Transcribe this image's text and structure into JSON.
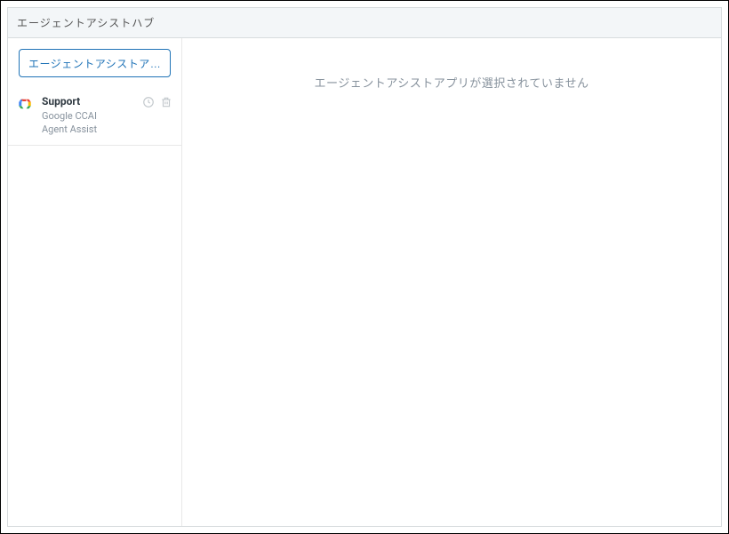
{
  "header": {
    "title": "エージェントアシストハブ"
  },
  "sidebar": {
    "add_button_label": "エージェントアシストアプ...",
    "items": [
      {
        "title": "Support",
        "subtitle_line1": "Google CCAI",
        "subtitle_line2": "Agent Assist"
      }
    ]
  },
  "main": {
    "empty_state_text": "エージェントアシストアプリが選択されていません"
  }
}
